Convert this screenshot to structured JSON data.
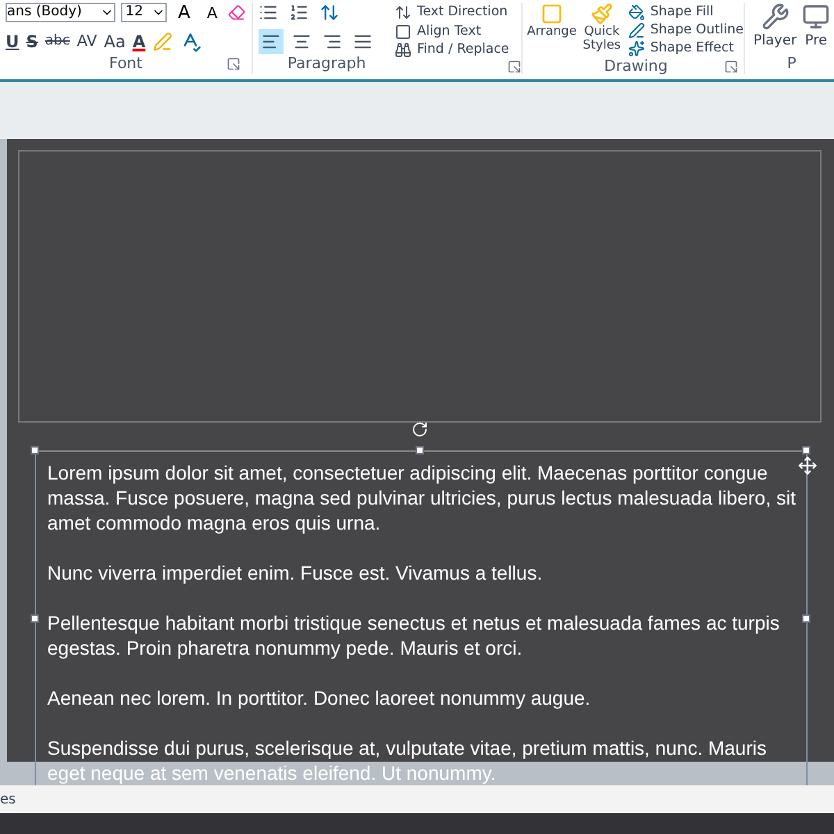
{
  "ribbon": {
    "groups": [
      {
        "kind": "font",
        "label": "Font",
        "font_field": "ans (Body)",
        "size_field": "12",
        "row1": [
          "A",
          "A"
        ],
        "row2": [
          "U",
          "S",
          "abc",
          "AV",
          "Aa",
          "A"
        ]
      },
      {
        "kind": "paragraph",
        "label": "Paragraph",
        "aligns": [
          {
            "selected": true
          },
          {
            "selected": false
          },
          {
            "selected": false
          },
          {
            "selected": false
          }
        ],
        "commands": [
          "Text Direction",
          "Align Text",
          "Find / Replace"
        ]
      },
      {
        "kind": "drawing",
        "label": "Drawing",
        "big": [
          "Arrange",
          "Quick Styles"
        ],
        "commands": [
          "Shape Fill",
          "Shape Outline",
          "Shape Effect"
        ]
      },
      {
        "kind": "media",
        "label": "P",
        "big": [
          "Player",
          "Pre"
        ]
      }
    ]
  },
  "slide": {
    "paragraphs": [
      "Lorem ipsum dolor sit amet, consectetuer adipiscing elit. Maecenas porttitor congue massa. Fusce posuere, magna sed pulvinar ultricies, purus lectus malesuada libero, sit amet commodo magna eros quis urna.",
      "Nunc viverra imperdiet enim. Fusce est. Vivamus a tellus.",
      "Pellentesque habitant morbi tristique senectus et netus et malesuada fames ac turpis egestas. Proin pharetra nonummy pede. Mauris et orci.",
      "Aenean nec lorem. In porttitor. Donec laoreet nonummy augue.",
      "Suspendisse dui purus, scelerisque at, vulputate vitae, pretium mattis, nunc. Mauris eget neque at sem venenatis eleifend. Ut nonummy."
    ]
  },
  "status_bar": {
    "text": "es"
  }
}
